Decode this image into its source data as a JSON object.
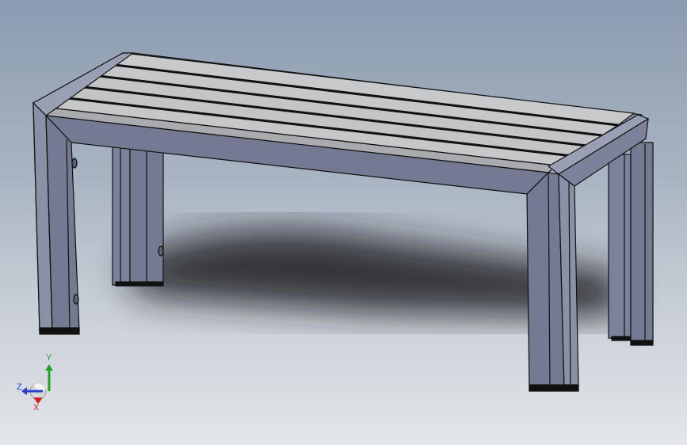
{
  "viewport": {
    "background_top": "#8b9bb0",
    "background_bottom": "#e3e6ea",
    "model": "bench"
  },
  "triad": {
    "x_label": "X",
    "y_label": "Y",
    "z_label": "Z",
    "x_color": "#cc1f1f",
    "y_color": "#22a22a",
    "z_color": "#2a3fc9"
  },
  "colors": {
    "frame_face": "#737a91",
    "frame_side": "#8a90a6",
    "frame_light": "#9aa0b4",
    "slat_top": "#c8c9cb",
    "slat_edge": "#a9abae",
    "outline": "#111111"
  }
}
